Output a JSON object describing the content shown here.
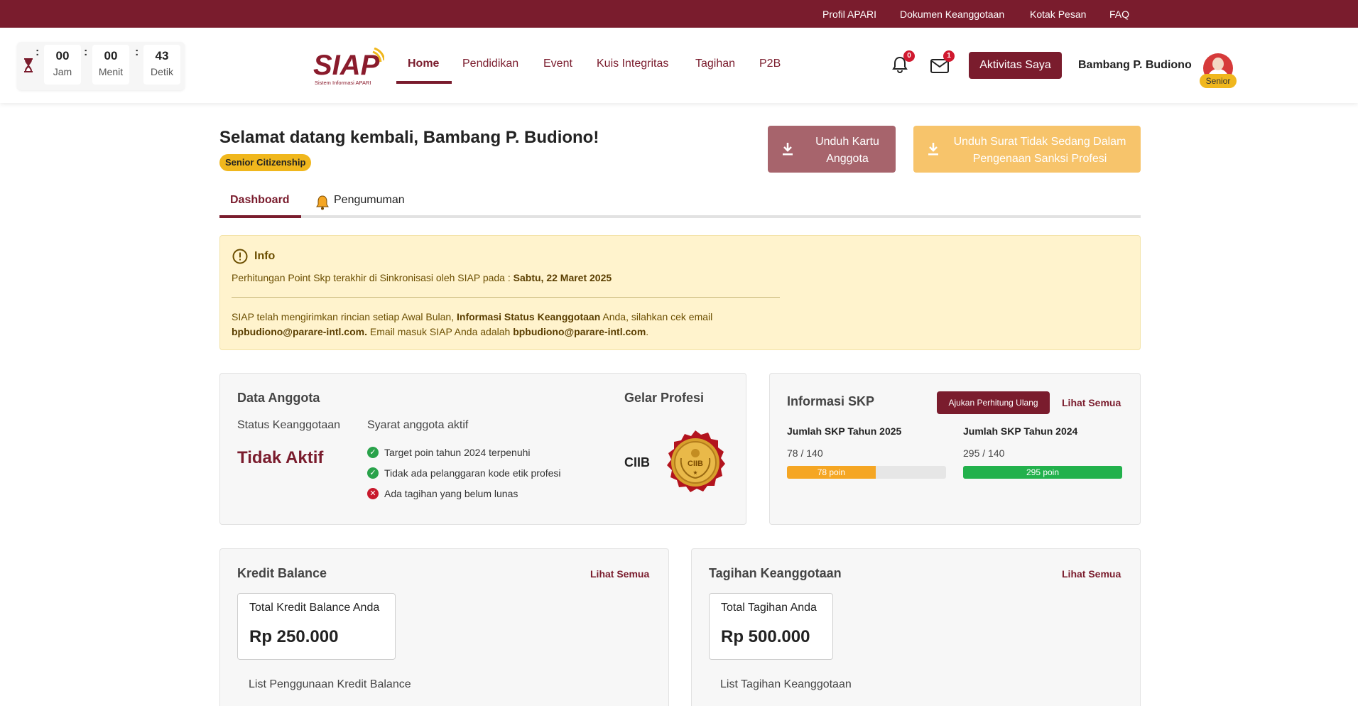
{
  "topbar": {
    "links": [
      "Profil APARI",
      "Dokumen Keanggotaan",
      "Kotak Pesan",
      "FAQ"
    ]
  },
  "timer": {
    "hours": "00",
    "hours_label": "Jam",
    "minutes": "00",
    "minutes_label": "Menit",
    "seconds": "43",
    "seconds_label": "Detik"
  },
  "logo": {
    "text": "SIAP",
    "subtitle": "Sistem Informasi APARI"
  },
  "nav": {
    "items": [
      "Home",
      "Pendidikan",
      "Event",
      "Kuis Integritas",
      "Tagihan",
      "P2B"
    ],
    "active": "Home"
  },
  "header": {
    "notification_count": "0",
    "message_count": "1",
    "activity_button": "Aktivitas Saya",
    "user_name": "Bambang P. Budiono",
    "user_level": "Senior"
  },
  "welcome": {
    "title": "Selamat datang kembali, Bambang P. Budiono!",
    "citizenship": "Senior Citizenship",
    "btn_kartu_line1": "Unduh Kartu",
    "btn_kartu_line2": "Anggota",
    "btn_surat_line1": "Unduh Surat Tidak Sedang Dalam",
    "btn_surat_line2": "Pengenaan Sanksi Profesi"
  },
  "tabs": {
    "dashboard": "Dashboard",
    "pengumuman": "Pengumuman"
  },
  "info": {
    "title": "Info",
    "line1_prefix": "Perhitungan Point Skp terakhir di Sinkronisasi oleh SIAP pada : ",
    "line1_date": "Sabtu, 22 Maret 2025",
    "line2_a": "SIAP telah mengirimkan rincian setiap Awal Bulan, ",
    "line2_b": "Informasi Status Keanggotaan",
    "line2_c": " Anda, silahkan cek email",
    "line3_email1": "bpbudiono@parare-intl.com.",
    "line3_mid": " Email masuk SIAP Anda adalah ",
    "line3_email2": "bpbudiono@parare-intl.com",
    "line3_end": "."
  },
  "data_anggota": {
    "title": "Data Anggota",
    "status_label": "Status Keanggotaan",
    "status_value": "Tidak Aktif",
    "syarat_label": "Syarat anggota aktif",
    "conditions": [
      {
        "text": "Target poin tahun 2024 terpenuhi",
        "met": true
      },
      {
        "text": "Tidak ada pelanggaran kode etik profesi",
        "met": true
      },
      {
        "text": "Ada tagihan yang belum lunas",
        "met": false
      }
    ],
    "gelar_title": "Gelar Profesi",
    "gelar_value": "CIIB"
  },
  "skp": {
    "title": "Informasi SKP",
    "ajukan_button": "Ajukan Perhitung Ulang",
    "lihat_semua": "Lihat Semua",
    "years": [
      {
        "label": "Jumlah SKP Tahun 2025",
        "value": "78 / 140",
        "bar_label": "78 poin",
        "fraction": 0.557,
        "color": "#f5a623"
      },
      {
        "label": "Jumlah SKP Tahun 2024",
        "value": "295 / 140",
        "bar_label": "295 poin",
        "fraction": 1.0,
        "color": "#22b14c"
      }
    ]
  },
  "kredit": {
    "title": "Kredit Balance",
    "lihat_semua": "Lihat Semua",
    "total_label": "Total Kredit Balance Anda",
    "total_value": "Rp 250.000",
    "list_label": "List Penggunaan Kredit Balance"
  },
  "tagihan": {
    "title": "Tagihan Keanggotaan",
    "lihat_semua": "Lihat Semua",
    "total_label": "Total Tagihan Anda",
    "total_value": "Rp 500.000",
    "list_label": "List Tagihan Keanggotaan"
  },
  "colors": {
    "brand": "#7a1c2d",
    "accent_yellow": "#f0b71d",
    "info_bg": "#fff3cd"
  }
}
